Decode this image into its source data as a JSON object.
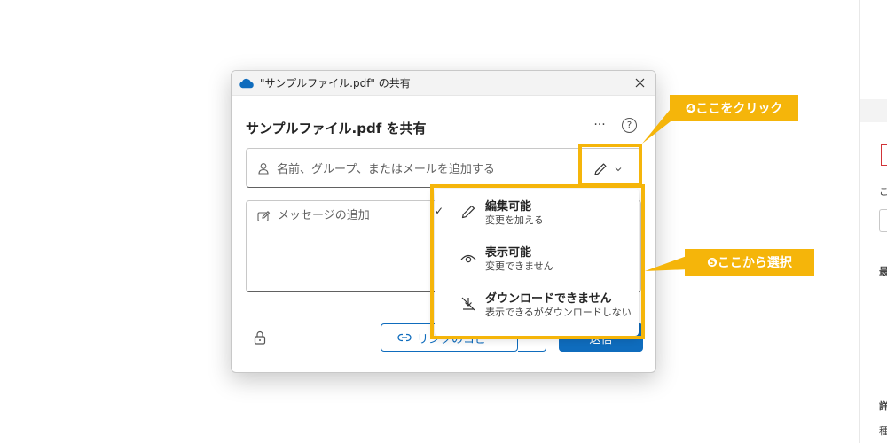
{
  "dialog": {
    "window_title": "\"サンプルファイル.pdf\" の共有",
    "heading": "サンプルファイル.pdf を共有",
    "more_label": "···",
    "help_label": "?",
    "recipient_placeholder": "名前、グループ、またはメールを追加する",
    "message_placeholder": "メッセージの追加",
    "copy_link_label": "リンクのコピー",
    "send_label": "送信"
  },
  "menu": {
    "items": [
      {
        "title": "編集可能",
        "subtitle": "変更を加える",
        "checked": "✓",
        "icon": "pencil-icon"
      },
      {
        "title": "表示可能",
        "subtitle": "変更できません",
        "checked": "",
        "icon": "eye-icon"
      },
      {
        "title": "ダウンロードできません",
        "subtitle": "表示できるがダウンロードしない",
        "checked": "",
        "icon": "no-download-icon"
      }
    ]
  },
  "annotations": {
    "step4": "❹ここをクリック",
    "step5": "❺ここから選択"
  },
  "background_panel": {
    "frag1": "こ",
    "frag2": "最",
    "frag3": "詳",
    "frag4": "種"
  },
  "colors": {
    "accent": "#0f6cbd",
    "highlight": "#f5b50a",
    "onedrive": "#0f6cbd"
  }
}
